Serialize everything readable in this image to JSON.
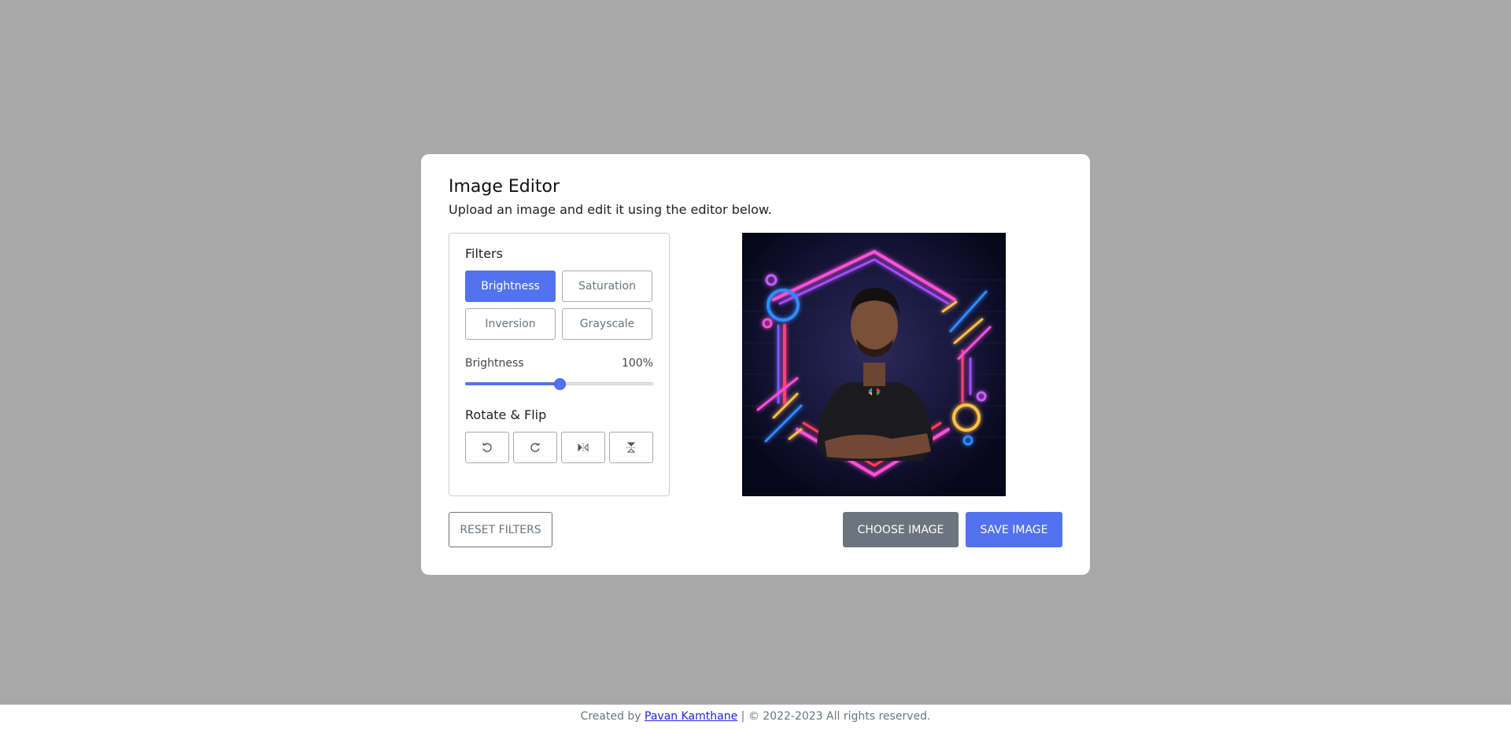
{
  "header": {
    "title": "Image Editor",
    "subtitle": "Upload an image and edit it using the editor below."
  },
  "filters": {
    "title": "Filters",
    "options": [
      "Brightness",
      "Saturation",
      "Inversion",
      "Grayscale"
    ],
    "active": "Brightness",
    "slider": {
      "label": "Brightness",
      "value_text": "100%",
      "value_fraction": 0.5
    }
  },
  "rotate": {
    "title": "Rotate & Flip",
    "buttons": [
      "rotate-left-icon",
      "rotate-right-icon",
      "flip-horizontal-icon",
      "flip-vertical-icon"
    ]
  },
  "preview": {
    "alt": "Man in black t-shirt with arms crossed framed by neon hexagon"
  },
  "actions": {
    "reset_label": "Reset Filters",
    "choose_label": "Choose Image",
    "save_label": "Save Image"
  },
  "footer": {
    "prefix": "Created by",
    "author": "Pavan Kamthane",
    "suffix": "| © 2022-2023 All rights reserved."
  },
  "colors": {
    "accent": "#5372f0",
    "secondary": "#6c757d",
    "background": "#a8a8a8"
  }
}
